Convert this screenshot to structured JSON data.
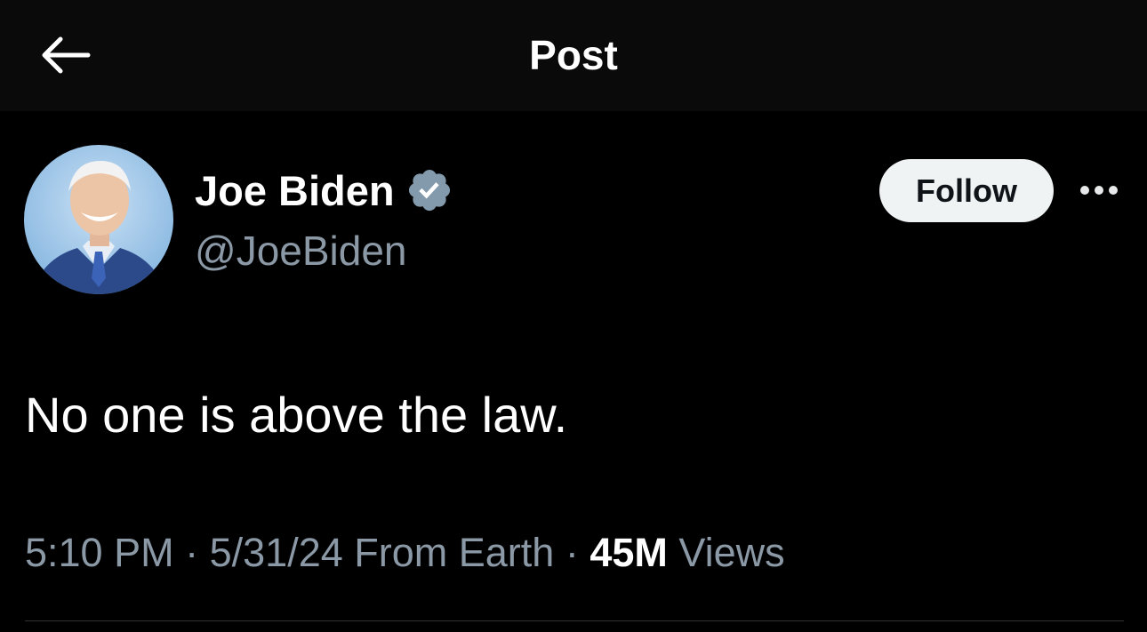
{
  "header": {
    "title": "Post",
    "back_icon": "arrow-left-icon"
  },
  "author": {
    "display_name": "Joe Biden",
    "handle": "@JoeBiden",
    "verified": true,
    "verified_color": "#829aab"
  },
  "actions": {
    "follow_label": "Follow",
    "more_icon": "ellipsis-icon"
  },
  "post": {
    "text": "No one is above the law."
  },
  "meta": {
    "time": "5:10 PM",
    "separator": "·",
    "date": "5/31/24",
    "source": "From Earth",
    "views_count": "45M",
    "views_label": "Views"
  },
  "colors": {
    "background": "#000000",
    "header_background": "#0a0a0a",
    "secondary_text": "#8b98a5",
    "follow_button_bg": "#eff3f4",
    "divider": "#2f3336"
  }
}
